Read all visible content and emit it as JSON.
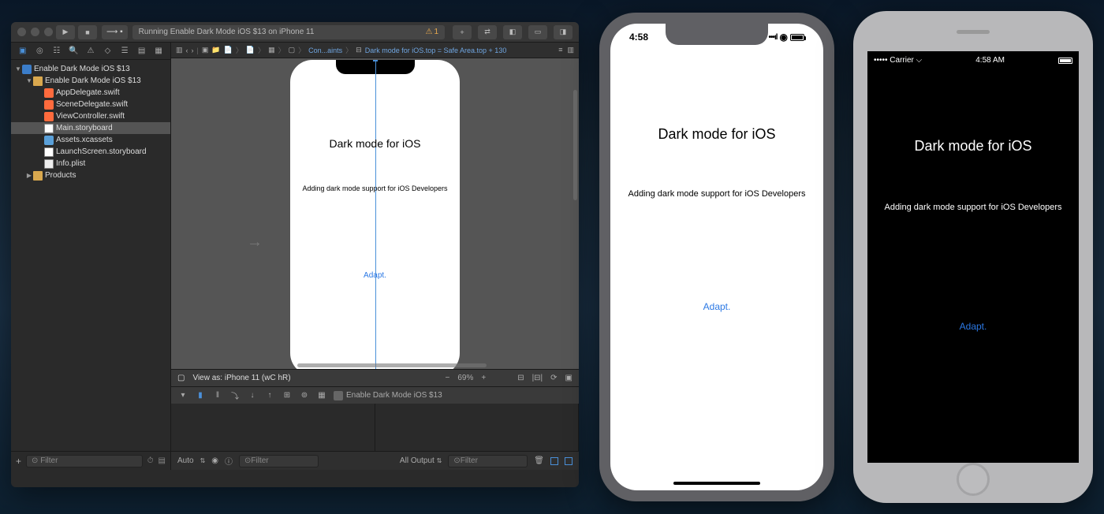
{
  "xcode": {
    "toolbar": {
      "scheme": "⟶ ▪",
      "status": "Running Enable Dark Mode iOS $13 on iPhone 11",
      "warnings": "1"
    },
    "navigator": {
      "items": [
        {
          "label": "Enable Dark Mode iOS $13",
          "kind": "proj",
          "indent": 0,
          "disc": "▼"
        },
        {
          "label": "Enable Dark Mode iOS $13",
          "kind": "folder",
          "indent": 1,
          "disc": "▼"
        },
        {
          "label": "AppDelegate.swift",
          "kind": "swift",
          "indent": 2,
          "disc": ""
        },
        {
          "label": "SceneDelegate.swift",
          "kind": "swift",
          "indent": 2,
          "disc": ""
        },
        {
          "label": "ViewController.swift",
          "kind": "swift",
          "indent": 2,
          "disc": ""
        },
        {
          "label": "Main.storyboard",
          "kind": "sb",
          "indent": 2,
          "disc": "",
          "sel": true
        },
        {
          "label": "Assets.xcassets",
          "kind": "assets",
          "indent": 2,
          "disc": ""
        },
        {
          "label": "LaunchScreen.storyboard",
          "kind": "sb",
          "indent": 2,
          "disc": ""
        },
        {
          "label": "Info.plist",
          "kind": "plist",
          "indent": 2,
          "disc": ""
        },
        {
          "label": "Products",
          "kind": "folder",
          "indent": 1,
          "disc": "▶"
        }
      ],
      "filter_placeholder": "Filter"
    },
    "jumpbar": {
      "crumbs": [
        "Con...aints",
        "Dark mode for iOS.top = Safe Area.top + 130"
      ]
    },
    "canvas": {
      "title": "Dark mode for iOS",
      "subtitle": "Adding dark mode support for iOS Developers",
      "button": "Adapt."
    },
    "viewas": {
      "label": "View as: iPhone 11 (wC hR)",
      "zoom": "69%"
    },
    "debug": {
      "app": "Enable Dark Mode iOS $13"
    },
    "bottombar": {
      "auto": "Auto",
      "filter1": "Filter",
      "alloutput": "All Output",
      "filter2": "Filter"
    }
  },
  "sim_light": {
    "time": "4:58",
    "title": "Dark mode for iOS",
    "subtitle": "Adding dark mode support for iOS Developers",
    "button": "Adapt."
  },
  "sim_dark": {
    "carrier": "Carrier",
    "time": "4:58 AM",
    "title": "Dark mode for iOS",
    "subtitle": "Adding dark mode support for iOS Developers",
    "button": "Adapt."
  }
}
